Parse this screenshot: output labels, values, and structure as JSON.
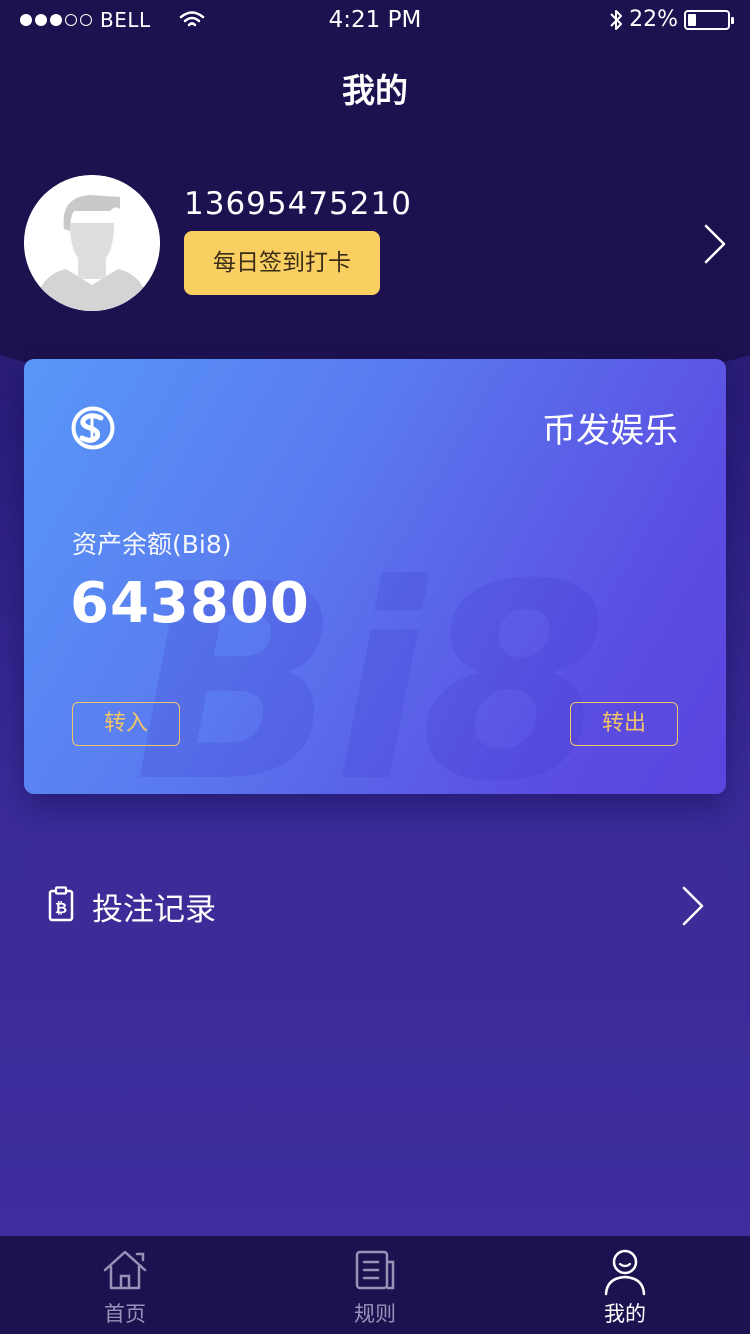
{
  "status_bar": {
    "carrier": "BELL",
    "time": "4:21 PM",
    "battery_percent_text": "22%",
    "battery_level": 0.22
  },
  "header": {
    "title": "我的"
  },
  "profile": {
    "phone": "13695475210",
    "checkin_label": "每日签到打卡",
    "avatar_icon": "user-silhouette-icon"
  },
  "card": {
    "brand_name": "币发娱乐",
    "logo_icon": "brand-s-logo-icon",
    "watermark": "Bi8",
    "balance_label": "资产余额(Bi8)",
    "balance_value": "643800",
    "transfer_in_label": "转入",
    "transfer_out_label": "转出"
  },
  "menu": {
    "bet_record_label": "投注记录",
    "bet_record_icon": "bitcoin-clipboard-icon"
  },
  "tabs": [
    {
      "label": "首页",
      "icon": "home-icon",
      "active": false
    },
    {
      "label": "规则",
      "icon": "document-icon",
      "active": false
    },
    {
      "label": "我的",
      "icon": "person-icon",
      "active": true
    }
  ],
  "colors": {
    "accent_yellow": "#f9cf62",
    "button_outline": "#f2c46a",
    "background_dark": "#1d124f",
    "card_gradient_start": "#5897f7",
    "card_gradient_end": "#5a45de"
  }
}
